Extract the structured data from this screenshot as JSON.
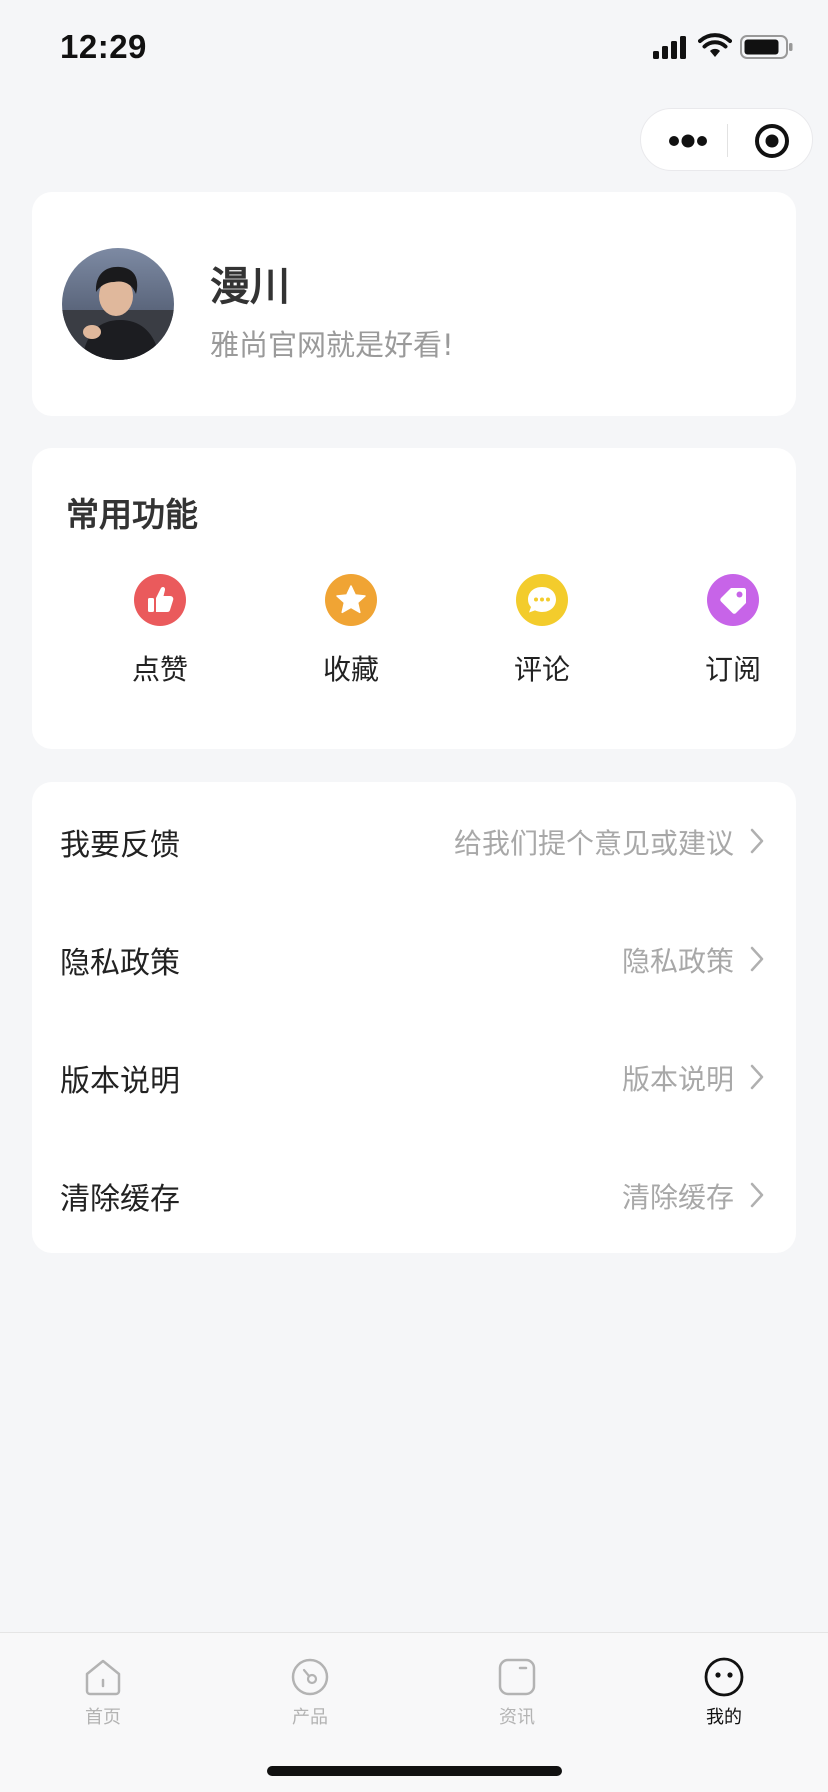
{
  "status_bar": {
    "time": "12:29"
  },
  "capsule": {
    "more_icon": "more-dots-icon",
    "close_icon": "target-circle-icon"
  },
  "profile": {
    "name": "漫川",
    "motto": "雅尚官网就是好看!",
    "avatar_icon": "avatar-photo"
  },
  "features": {
    "title": "常用功能",
    "items": [
      {
        "label": "点赞",
        "icon": "thumbs-up-icon",
        "color": "#ea5a5c"
      },
      {
        "label": "收藏",
        "icon": "star-icon",
        "color": "#f0a434"
      },
      {
        "label": "评论",
        "icon": "comment-icon",
        "color": "#f3cc2c"
      },
      {
        "label": "订阅",
        "icon": "tag-icon",
        "color": "#c764e8"
      }
    ]
  },
  "menu": {
    "items": [
      {
        "label": "我要反馈",
        "value": "给我们提个意见或建议"
      },
      {
        "label": "隐私政策",
        "value": "隐私政策"
      },
      {
        "label": "版本说明",
        "value": "版本说明"
      },
      {
        "label": "清除缓存",
        "value": "清除缓存"
      }
    ]
  },
  "tab_bar": {
    "tabs": [
      {
        "label": "首页",
        "icon": "home-icon",
        "active": false
      },
      {
        "label": "产品",
        "icon": "product-icon",
        "active": false
      },
      {
        "label": "资讯",
        "icon": "news-icon",
        "active": false
      },
      {
        "label": "我的",
        "icon": "profile-icon",
        "active": true
      }
    ]
  },
  "colors": {
    "background": "#f5f6f8",
    "card": "#ffffff",
    "muted_text": "#a8a8a8"
  }
}
